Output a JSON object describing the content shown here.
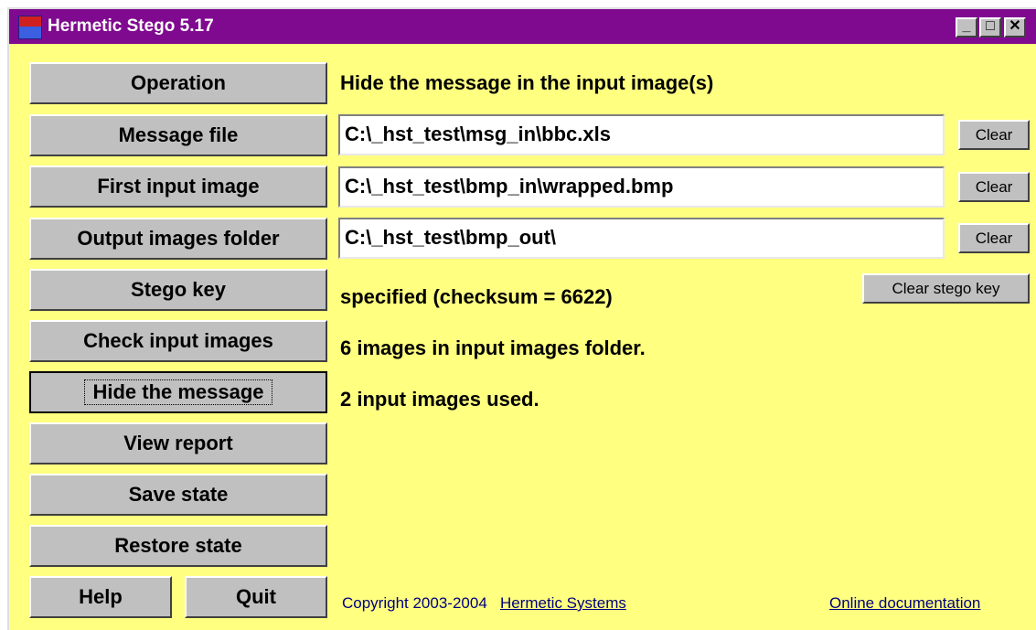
{
  "window": {
    "title": "Hermetic Stego 5.17",
    "minimize_glyph": "_",
    "maximize_glyph": "□",
    "close_glyph": "✕"
  },
  "left_buttons": {
    "operation": "Operation",
    "message_file": "Message file",
    "first_input_image": "First input image",
    "output_images_folder": "Output images folder",
    "stego_key": "Stego key",
    "check_input_images": "Check input images",
    "hide_the_message": "Hide the message",
    "view_report": "View report",
    "save_state": "Save state",
    "restore_state": "Restore state",
    "help": "Help",
    "quit": "Quit"
  },
  "main": {
    "operation_text": "Hide the message in the input image(s)",
    "message_file_path": "C:\\_hst_test\\msg_in\\bbc.xls",
    "first_input_image_path": "C:\\_hst_test\\bmp_in\\wrapped.bmp",
    "output_folder_path": "C:\\_hst_test\\bmp_out\\",
    "clear_label": "Clear",
    "clear_stego_key_label": "Clear stego key",
    "stego_key_status": "specified (checksum = 6622)",
    "check_status": "6 images in input images folder.",
    "hide_status": "2 input images used."
  },
  "footer": {
    "copyright": "Copyright 2003-2004",
    "company_link": "Hermetic Systems",
    "docs_link": "Online documentation"
  },
  "colors": {
    "background": "#ffff80",
    "titlebar": "#7f0a8f",
    "button_face": "#c0c0c0",
    "link": "#000080"
  }
}
